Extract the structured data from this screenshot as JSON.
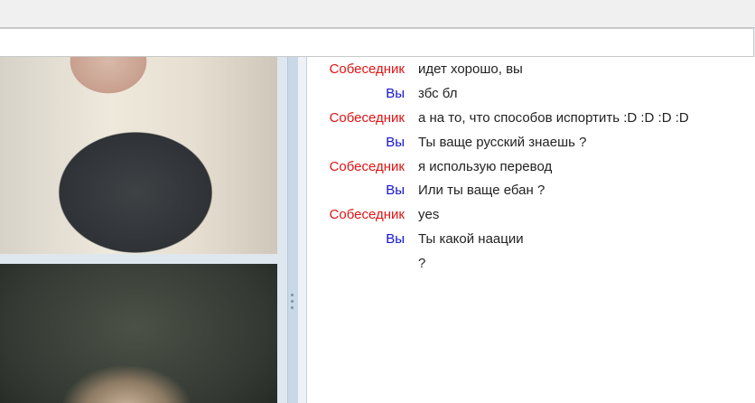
{
  "chat": {
    "messages": [
      {
        "sender": "Собеседник",
        "text": "идет хорошо, вы",
        "role": "partner"
      },
      {
        "sender": "Вы",
        "text": "збс бл",
        "role": "you"
      },
      {
        "sender": "Собеседник",
        "text": "а на то, что способов испортить :D :D :D :D",
        "role": "partner"
      },
      {
        "sender": "Вы",
        "text": "Ты ваще русский знаешь ?",
        "role": "you"
      },
      {
        "sender": "Собеседник",
        "text": "я использую перевод",
        "role": "partner"
      },
      {
        "sender": "Вы",
        "text": "Или ты ваще ебан ?",
        "role": "you"
      },
      {
        "sender": "Собеседник",
        "text": "yes",
        "role": "partner"
      },
      {
        "sender": "Вы",
        "text": "Ты какой наации",
        "role": "you"
      },
      {
        "sender": "",
        "text": "?",
        "role": "you"
      }
    ]
  },
  "colors": {
    "partner_label": "#e01414",
    "you_label": "#1515d0"
  }
}
